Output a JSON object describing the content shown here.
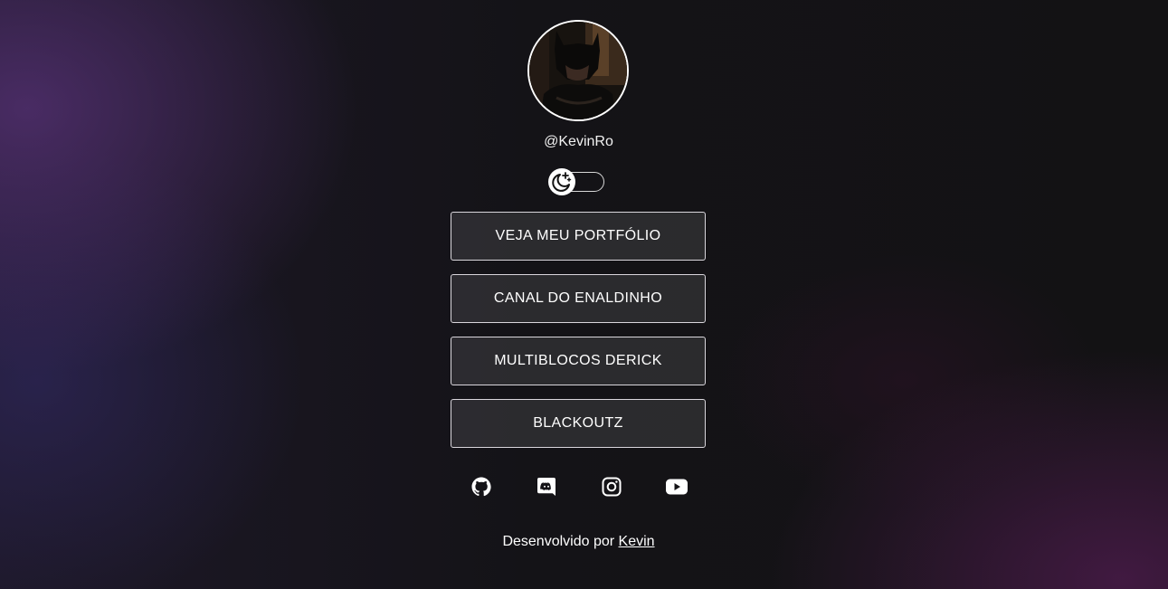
{
  "profile": {
    "username": "@KevinRo",
    "avatar_icon": "profile-photo"
  },
  "theme_toggle": {
    "icon": "moon-stars-icon",
    "state": "dark"
  },
  "links": [
    {
      "label": "VEJA MEU PORTFÓLIO"
    },
    {
      "label": "CANAL DO ENALDINHO"
    },
    {
      "label": "MULTIBLOCOS DERICK"
    },
    {
      "label": "BLACKOUTZ"
    }
  ],
  "socials": [
    {
      "icon": "github-icon"
    },
    {
      "icon": "discord-icon"
    },
    {
      "icon": "instagram-icon"
    },
    {
      "icon": "youtube-icon"
    }
  ],
  "footer": {
    "prefix": "Desenvolvido por",
    "author": "Kevin"
  },
  "colors": {
    "text": "#ffffff",
    "button_border": "#d9d6dc",
    "background": "#141317",
    "accent_purple": "#58327a"
  }
}
